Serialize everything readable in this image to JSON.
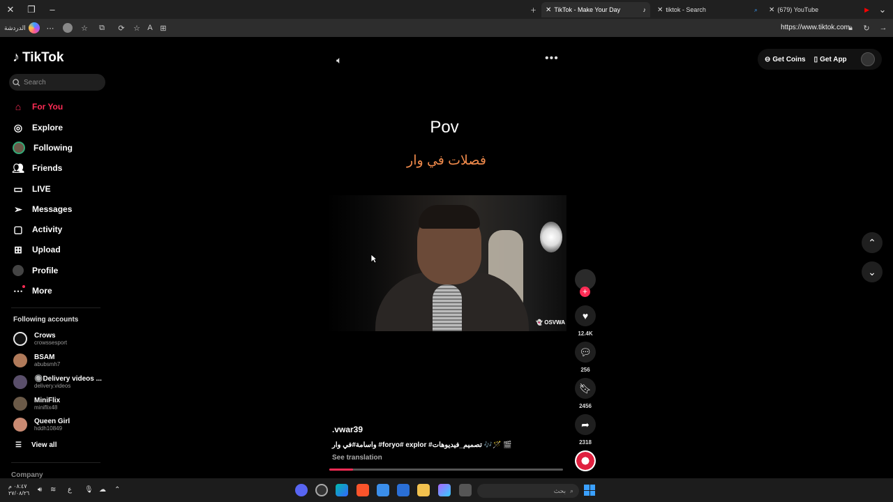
{
  "browser": {
    "tabs": [
      {
        "title": "TikTok - Make Your Day",
        "active": true
      },
      {
        "title": "tiktok - Search",
        "active": false
      },
      {
        "title": "(679) YouTube",
        "active": false
      }
    ],
    "profile_label": "الدردشة",
    "url": "https://www.tiktok.com"
  },
  "sidebar": {
    "brand": "TikTok",
    "search_placeholder": "Search",
    "nav": [
      {
        "label": "For You",
        "icon": "home-icon"
      },
      {
        "label": "Explore",
        "icon": "compass-icon"
      },
      {
        "label": "Following",
        "icon": "following-avatar-icon"
      },
      {
        "label": "Friends",
        "icon": "friends-icon"
      },
      {
        "label": "LIVE",
        "icon": "live-icon"
      },
      {
        "label": "Messages",
        "icon": "send-icon"
      },
      {
        "label": "Activity",
        "icon": "inbox-icon"
      },
      {
        "label": "Upload",
        "icon": "plus-square-icon"
      },
      {
        "label": "Profile",
        "icon": "profile-avatar-icon"
      },
      {
        "label": "More",
        "icon": "more-icon"
      }
    ],
    "following_title": "Following accounts",
    "accounts": [
      {
        "name": "Crows",
        "handle": "crowssesport",
        "color": "#e8e8e8"
      },
      {
        "name": "BSAM",
        "handle": "abubsmh7",
        "color": "#b07a5a"
      },
      {
        "name": "🔘Delivery videos ...",
        "handle": "delivery.videos",
        "color": "#5a4f6b"
      },
      {
        "name": "MiniFlix",
        "handle": "miniflix48",
        "color": "#6b5a48"
      },
      {
        "name": "Queen Girl",
        "handle": "hddh10849",
        "color": "#c98a72"
      }
    ],
    "view_all": "View all",
    "company": "Company"
  },
  "video": {
    "title_overlay": "Pov",
    "arabic_overlay": "فصلات في وار",
    "watermark": "OSVWA",
    "author": ".vwar39",
    "caption": "‏🎬 🪄🎶 تصميم_فيديوهات# foryo# explor# واسامة#في وار",
    "see_translation": "See translation",
    "progress": 0.1
  },
  "actions": {
    "likes": "12.4K",
    "comments": "256",
    "saves": "2456",
    "shares": "2318"
  },
  "header": {
    "get_coins": "Get Coins",
    "get_app": "Get App"
  },
  "taskbar": {
    "time": "٠٨:٤٧ م",
    "date": "٢٧/٠٨/٢٦",
    "lang": "ع",
    "search_label": "بحث"
  },
  "colors": {
    "accent": "#fe2c55",
    "overlay_arabic": "#f08a4b"
  }
}
